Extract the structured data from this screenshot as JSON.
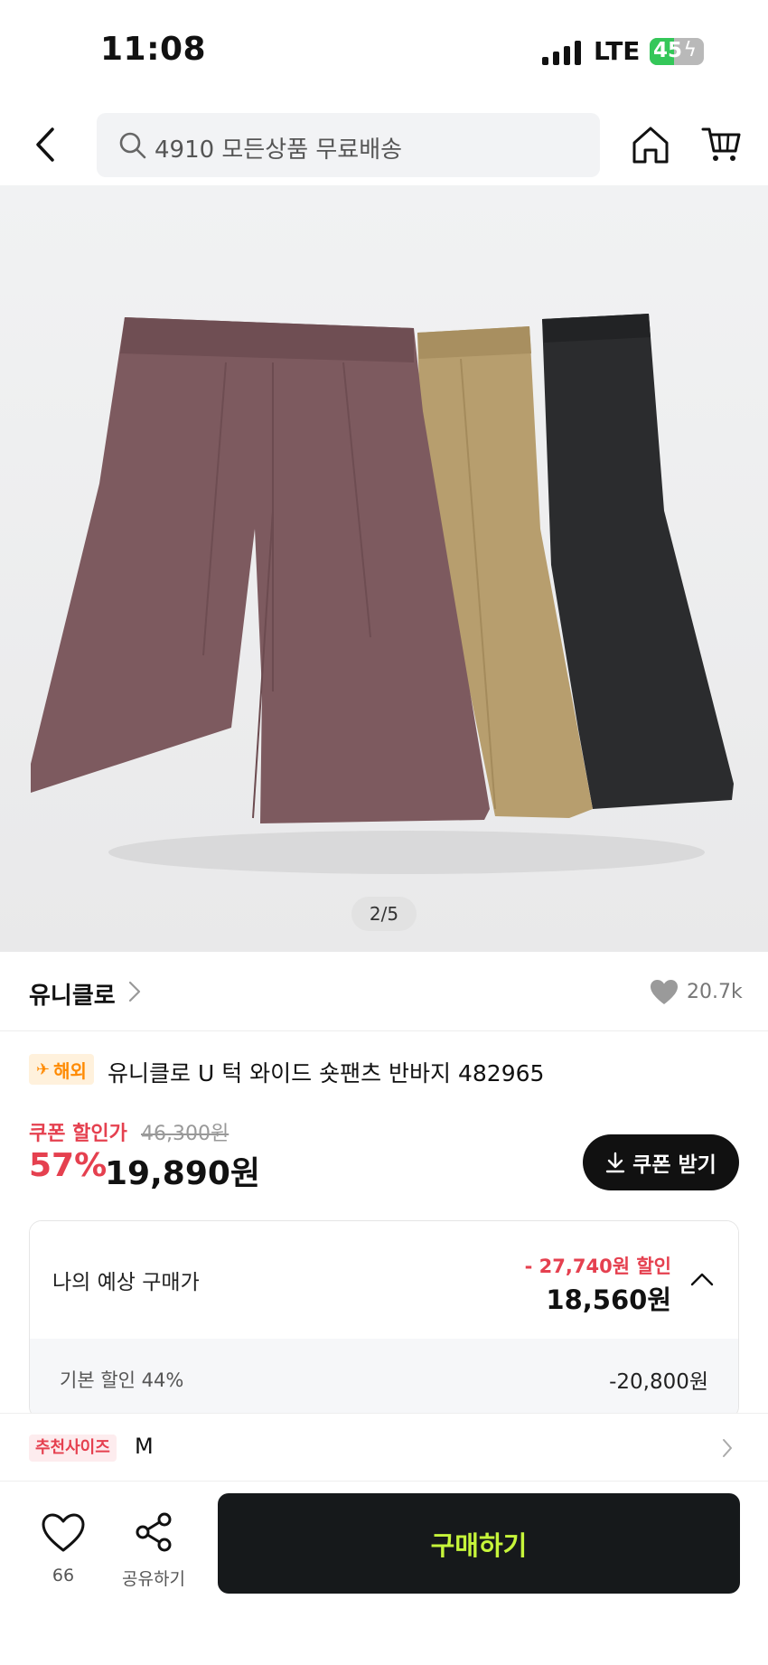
{
  "status_bar": {
    "time": "11:08",
    "network": "LTE",
    "battery_pct": "45",
    "battery_level": 0.45
  },
  "header": {
    "search_placeholder": "4910 모든상품 무료배송",
    "icons": [
      "back-icon",
      "search-icon",
      "home-icon",
      "cart-icon"
    ]
  },
  "gallery": {
    "indicator": "2/5",
    "current": 2,
    "total": 5
  },
  "brand": {
    "name": "유니클로",
    "likes": "20.7k"
  },
  "product": {
    "badge": "해외",
    "title": "유니클로 U 턱 와이드 숏팬츠 반바지 482965"
  },
  "price": {
    "coupon_label": "쿠폰 할인가",
    "original": "46,300원",
    "discount_rate": "57%",
    "sale": "19,890원",
    "coupon_button": "쿠폰 받기"
  },
  "expected": {
    "label": "나의 예상 구매가",
    "discount": "- 27,740원 할인",
    "price": "18,560원",
    "detail_label": "기본 할인 44%",
    "detail_value": "-20,800원"
  },
  "size": {
    "badge": "추천사이즈",
    "value": "M"
  },
  "bottom": {
    "wish_count": "66",
    "share_label": "공유하기",
    "buy_label": "구매하기"
  },
  "colors": {
    "accent_red": "#e5404f",
    "buy_text": "#c6f53a",
    "buy_bg": "#16191b",
    "overseas": "#ff8a00"
  }
}
